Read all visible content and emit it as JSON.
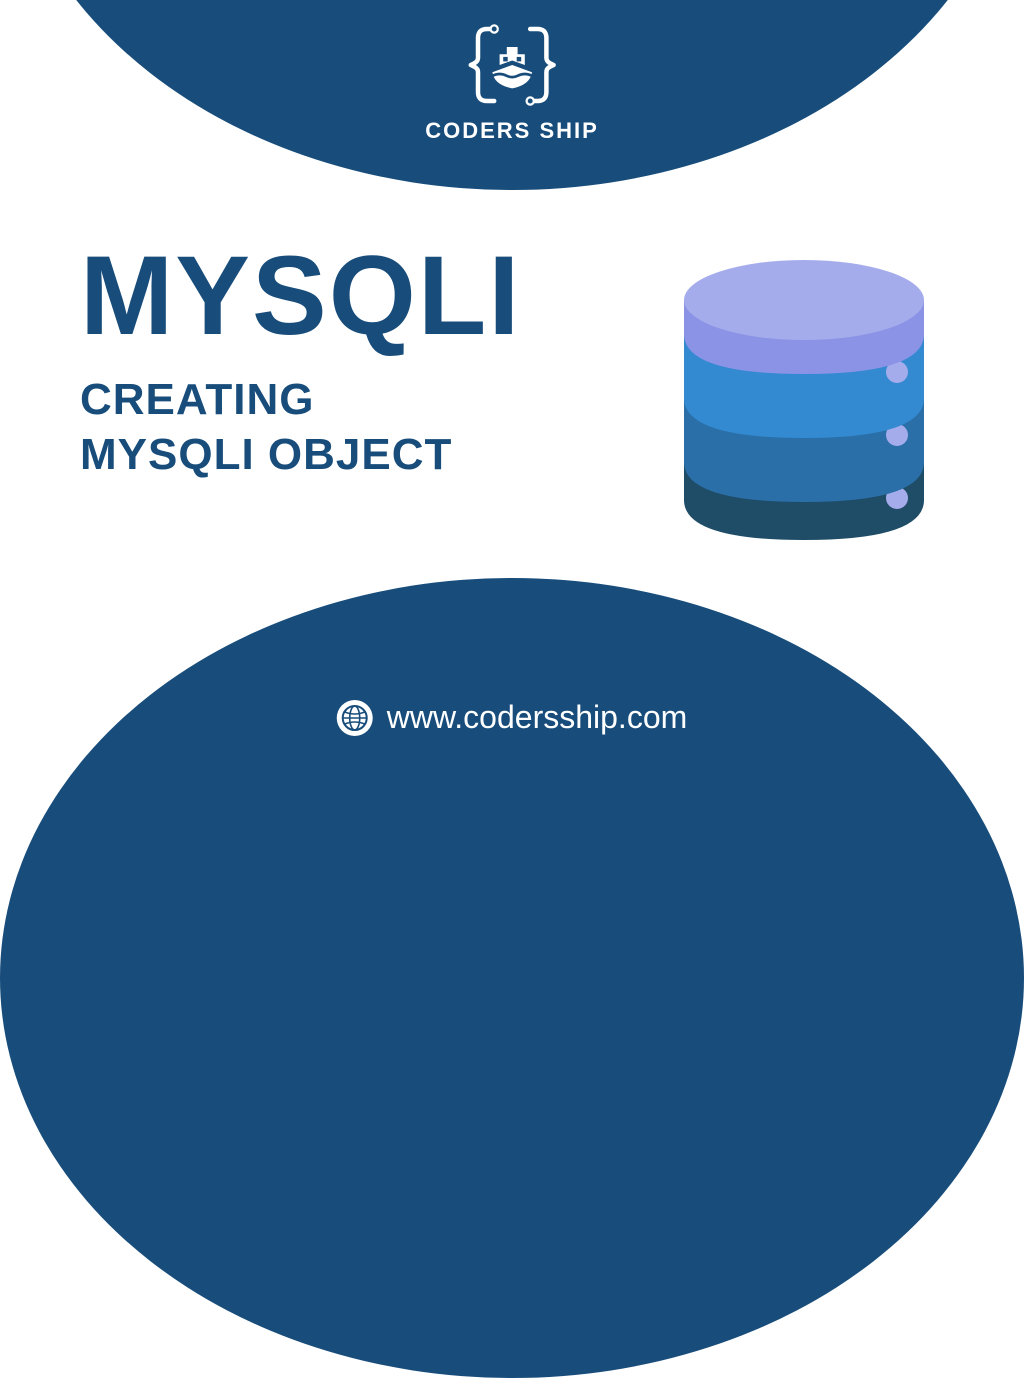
{
  "brand": {
    "name": "CODERS SHIP"
  },
  "content": {
    "title": "MYSQLI",
    "subtitle_line1": "CREATING",
    "subtitle_line2": "MYSQLI OBJECT"
  },
  "footer": {
    "url": "www.codersship.com"
  },
  "colors": {
    "primary": "#184d7b",
    "db_top": "#a5aceb",
    "db_mid1": "#338ad1",
    "db_mid2": "#2a6fa8",
    "db_bottom": "#1f4c66"
  }
}
